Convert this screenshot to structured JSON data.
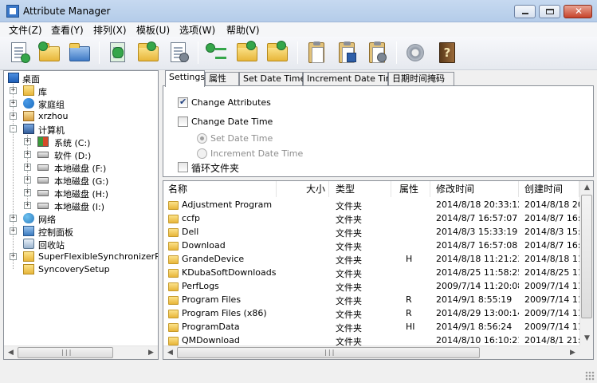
{
  "window": {
    "title": "Attribute Manager",
    "controls": [
      "minimize",
      "maximize",
      "close"
    ]
  },
  "menu": [
    "文件(Z)",
    "查看(Y)",
    "排列(X)",
    "模板(U)",
    "选项(W)",
    "帮助(V)"
  ],
  "toolbar": {
    "icons": [
      "document-checklist-icon",
      "folder-check-icon",
      "folder-stack-icon",
      "sync-icon",
      "folder-up-arrow-icon",
      "document-gear-icon",
      "add-sort-icon",
      "add-folder-icon",
      "remove-folder-icon",
      "clipboard-icon",
      "clipboard-save-icon",
      "clipboard-gear-icon",
      "settings-gear-icon",
      "help-book-icon"
    ]
  },
  "tree": {
    "items": [
      {
        "label": "桌面",
        "icon": "desktop-icon",
        "level": 0,
        "expander": "-"
      },
      {
        "label": "库",
        "icon": "library-icon",
        "level": 1,
        "expander": "+"
      },
      {
        "label": "家庭组",
        "icon": "homegroup-icon",
        "level": 1,
        "expander": "+"
      },
      {
        "label": "xrzhou",
        "icon": "user-icon",
        "level": 1,
        "expander": "+"
      },
      {
        "label": "计算机",
        "icon": "computer-icon",
        "level": 1,
        "expander": "-"
      },
      {
        "label": "系统 (C:)",
        "icon": "system-drive-icon",
        "level": 2,
        "expander": "+"
      },
      {
        "label": "软件 (D:)",
        "icon": "drive-icon",
        "level": 2,
        "expander": "+"
      },
      {
        "label": "本地磁盘 (F:)",
        "icon": "drive-icon",
        "level": 2,
        "expander": "+"
      },
      {
        "label": "本地磁盘 (G:)",
        "icon": "drive-icon",
        "level": 2,
        "expander": "+"
      },
      {
        "label": "本地磁盘 (H:)",
        "icon": "drive-icon",
        "level": 2,
        "expander": "+"
      },
      {
        "label": "本地磁盘 (I:)",
        "icon": "drive-icon",
        "level": 2,
        "expander": "+"
      },
      {
        "label": "网络",
        "icon": "network-icon",
        "level": 1,
        "expander": "+"
      },
      {
        "label": "控制面板",
        "icon": "control-panel-icon",
        "level": 1,
        "expander": "+"
      },
      {
        "label": "回收站",
        "icon": "recycle-bin-icon",
        "level": 1,
        "expander": ""
      },
      {
        "label": "SuperFlexibleSynchronizerPorta",
        "icon": "folder-icon",
        "level": 1,
        "expander": "+"
      },
      {
        "label": "SyncoverySetup",
        "icon": "folder-icon",
        "level": 1,
        "expander": ""
      }
    ]
  },
  "tabs": [
    {
      "label": "Settings",
      "active": true
    },
    {
      "label": "属性",
      "active": false
    },
    {
      "label": "Set Date Time",
      "active": false
    },
    {
      "label": "Increment Date Time",
      "active": false
    },
    {
      "label": "日期时间掩码",
      "active": false
    }
  ],
  "settings": {
    "change_attributes": {
      "label": "Change Attributes",
      "checked": true
    },
    "change_date_time": {
      "label": "Change Date Time",
      "checked": false
    },
    "set_date_time": {
      "label": "Set Date Time",
      "selected": true,
      "enabled": false
    },
    "increment_date_time": {
      "label": "Increment Date Time",
      "selected": false,
      "enabled": false
    },
    "loop_folder": {
      "label": "循环文件夹",
      "checked": false
    }
  },
  "filelist": {
    "columns": [
      "名称",
      "大小",
      "类型",
      "属性",
      "修改时间",
      "创建时间"
    ],
    "rows": [
      {
        "name": "Adjustment Program",
        "size": "",
        "type": "文件夹",
        "attr": "",
        "modified": "2014/8/18 20:33:12",
        "created": "2014/8/18 20:"
      },
      {
        "name": "ccfp",
        "size": "",
        "type": "文件夹",
        "attr": "",
        "modified": "2014/8/7 16:57:07",
        "created": "2014/8/7 16:"
      },
      {
        "name": "Dell",
        "size": "",
        "type": "文件夹",
        "attr": "",
        "modified": "2014/8/3 15:33:19",
        "created": "2014/8/3 15:"
      },
      {
        "name": "Download",
        "size": "",
        "type": "文件夹",
        "attr": "",
        "modified": "2014/8/7 16:57:08",
        "created": "2014/8/7 16:"
      },
      {
        "name": "GrandeDevice",
        "size": "",
        "type": "文件夹",
        "attr": "H",
        "modified": "2014/8/18 11:21:23",
        "created": "2014/8/18 11"
      },
      {
        "name": "KDubaSoftDownloads",
        "size": "",
        "type": "文件夹",
        "attr": "",
        "modified": "2014/8/25 11:58:25",
        "created": "2014/8/25 11"
      },
      {
        "name": "PerfLogs",
        "size": "",
        "type": "文件夹",
        "attr": "",
        "modified": "2009/7/14 11:20:08",
        "created": "2009/7/14 11"
      },
      {
        "name": "Program Files",
        "size": "",
        "type": "文件夹",
        "attr": "R",
        "modified": "2014/9/1 8:55:19",
        "created": "2009/7/14 11"
      },
      {
        "name": "Program Files (x86)",
        "size": "",
        "type": "文件夹",
        "attr": "R",
        "modified": "2014/8/29 13:00:14",
        "created": "2009/7/14 11"
      },
      {
        "name": "ProgramData",
        "size": "",
        "type": "文件夹",
        "attr": "HI",
        "modified": "2014/9/1 8:56:24",
        "created": "2009/7/14 11"
      },
      {
        "name": "QMDownload",
        "size": "",
        "type": "文件夹",
        "attr": "",
        "modified": "2014/8/10 16:10:21",
        "created": "2014/8/1 21:"
      }
    ]
  },
  "scroll": {
    "left_arrow": "◀",
    "right_arrow": "▶",
    "up_arrow": "▲",
    "down_arrow": "▼",
    "grip": "|||"
  }
}
